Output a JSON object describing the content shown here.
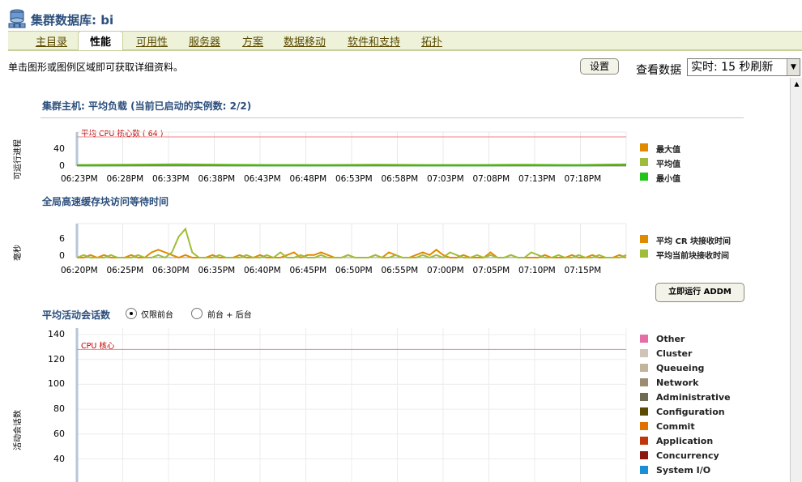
{
  "header": {
    "title": "集群数据库: bi"
  },
  "tabs": [
    {
      "label": "主目录"
    },
    {
      "label": "性能",
      "active": true
    },
    {
      "label": "可用性"
    },
    {
      "label": "服务器"
    },
    {
      "label": "方案"
    },
    {
      "label": "数据移动"
    },
    {
      "label": "软件和支持"
    },
    {
      "label": "拓扑"
    }
  ],
  "toolbar": {
    "instruction": "单击图形或图例区域即可获取详细资料。",
    "settings_label": "设置",
    "view_data_label": "查看数据",
    "view_data_value": "实时: 15 秒刷新"
  },
  "chart_data": [
    {
      "type": "line",
      "title": "集群主机: 平均负载 (当前已启动的实例数: 2/2)",
      "ylabel": "可运行进程",
      "ylim": [
        0,
        58
      ],
      "yticks": [
        "40",
        "0"
      ],
      "reference_line": {
        "label": "平均 CPU 核心数 ( 64 )",
        "value": 64
      },
      "x": [
        "06:23PM",
        "06:28PM",
        "06:33PM",
        "06:38PM",
        "06:43PM",
        "06:48PM",
        "06:53PM",
        "06:58PM",
        "07:03PM",
        "07:08PM",
        "07:13PM",
        "07:18PM"
      ],
      "series": [
        {
          "name": "最大值",
          "color": "#e08a00",
          "values": [
            2,
            2.5,
            3,
            2.5,
            2,
            2,
            2.5,
            2,
            2,
            2.5,
            2,
            3
          ]
        },
        {
          "name": "平均值",
          "color": "#9fbd3a",
          "values": [
            1.5,
            1.8,
            2.2,
            1.9,
            1.6,
            1.5,
            1.8,
            1.5,
            1.6,
            1.9,
            1.6,
            2.2
          ]
        },
        {
          "name": "最小值",
          "color": "#22c41c",
          "values": [
            1,
            1.2,
            1.5,
            1.3,
            1.1,
            1,
            1.2,
            1,
            1.1,
            1.3,
            1.1,
            1.5
          ]
        }
      ]
    },
    {
      "type": "line",
      "title": "全局高速缓存块访问等待时间",
      "ylabel": "毫秒",
      "ylim": [
        0,
        13
      ],
      "yticks": [
        "6",
        "0"
      ],
      "x": [
        "06:20PM",
        "06:25PM",
        "06:30PM",
        "06:35PM",
        "06:40PM",
        "06:45PM",
        "06:50PM",
        "06:55PM",
        "07:00PM",
        "07:05PM",
        "07:10PM",
        "07:15PM"
      ],
      "series": [
        {
          "name": "平均 CR 块接收时间",
          "color": "#e08a00",
          "values": [
            0,
            0,
            1,
            0,
            1,
            0,
            0,
            0,
            1,
            0,
            0,
            2,
            3,
            2,
            1,
            0,
            1,
            0,
            0,
            0,
            1,
            0,
            0,
            0,
            1,
            0,
            0,
            1,
            0,
            0,
            0,
            1,
            2,
            0,
            1,
            1,
            2,
            1,
            0,
            0,
            1,
            0,
            0,
            0,
            1,
            0,
            2,
            1,
            0,
            0,
            1,
            2,
            1,
            3,
            1,
            0,
            0,
            1,
            0,
            0,
            0,
            2,
            0,
            0,
            1,
            0,
            0,
            0,
            0,
            1,
            0,
            0,
            0,
            1,
            0,
            0,
            1,
            0,
            0,
            0,
            1,
            0
          ]
        },
        {
          "name": "平均当前块接收时间",
          "color": "#9fbd3a",
          "values": [
            0,
            1,
            0,
            0,
            0,
            1,
            0,
            0,
            0,
            1,
            0,
            0,
            1,
            0,
            2,
            8,
            11,
            2,
            0,
            0,
            0,
            1,
            0,
            0,
            0,
            1,
            0,
            0,
            1,
            0,
            2,
            0,
            0,
            1,
            0,
            0,
            1,
            0,
            0,
            0,
            1,
            0,
            0,
            0,
            1,
            0,
            0,
            1,
            0,
            0,
            0,
            1,
            0,
            1,
            0,
            2,
            1,
            0,
            0,
            1,
            0,
            1,
            0,
            0,
            1,
            0,
            0,
            2,
            1,
            0,
            0,
            1,
            0,
            0,
            1,
            0,
            0,
            1,
            0,
            0,
            0,
            1
          ]
        }
      ],
      "action_button": "立即运行 ADDM"
    },
    {
      "type": "area",
      "title": "平均活动会话数",
      "ylabel": "活动会话数",
      "ylim": [
        40,
        140
      ],
      "yticks": [
        "140",
        "120",
        "100",
        "80",
        "60",
        "40"
      ],
      "reference_line": {
        "label": "CPU 核心",
        "value": 128
      },
      "radio_options": [
        {
          "label": "仅限前台",
          "selected": true
        },
        {
          "label": "前台 + 后台",
          "selected": false
        }
      ],
      "legend": [
        {
          "name": "Other",
          "color": "#e46ea8"
        },
        {
          "name": "Cluster",
          "color": "#cfc5b7"
        },
        {
          "name": "Queueing",
          "color": "#c2b59b"
        },
        {
          "name": "Network",
          "color": "#9c8c72"
        },
        {
          "name": "Administrative",
          "color": "#6f6b52"
        },
        {
          "name": "Configuration",
          "color": "#5b4a00"
        },
        {
          "name": "Commit",
          "color": "#e07000"
        },
        {
          "name": "Application",
          "color": "#c0360a"
        },
        {
          "name": "Concurrency",
          "color": "#8a1a10"
        },
        {
          "name": "System I/O",
          "color": "#1a8fd6"
        }
      ]
    }
  ]
}
